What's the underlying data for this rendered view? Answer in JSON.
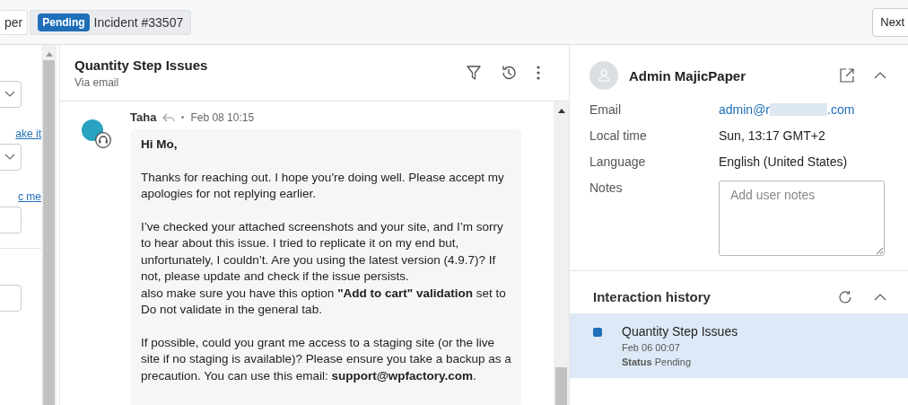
{
  "tabs": [
    {
      "label": "per",
      "selected": false
    },
    {
      "label": "Incident #33507",
      "badge": "Pending",
      "selected": true
    }
  ],
  "next_button": "Next",
  "left_panel": {
    "link_1": "ake it",
    "link_2": "c me"
  },
  "ticket": {
    "title": "Quantity Step Issues",
    "channel": "Via email"
  },
  "message": {
    "author": "Taha",
    "time": "Feb 08 10:15",
    "greeting": "Hi Mo,",
    "paragraphs": [
      "Thanks for reaching out. I hope you're doing well. Please accept my apologies for not replying earlier.",
      "I’ve checked your attached screenshots and your site, and I’m sorry to hear about this issue. I tried to replicate it on my end but, unfortunately, I couldn’t. Are you using the latest version (4.9.7)? If not, please update and check if the issue persists.\nalso make sure you have this option **\"Add to cart\" validation** set to Do not validate in the general tab.",
      "If possible, could you grant me access to a staging site (or the live site if no staging is available)? Please ensure you take a backup as a precaution. You can use this email: **support@wpfactory.com**."
    ]
  },
  "contact": {
    "name": "Admin MajicPaper",
    "fields": [
      {
        "label": "Email",
        "kind": "link",
        "value": "admin@r",
        "value_end": ".com"
      },
      {
        "label": "Local time",
        "kind": "text",
        "value": "Sun, 13:17 GMT+2"
      },
      {
        "label": "Language",
        "kind": "text",
        "value": "English (United States)"
      },
      {
        "label": "Notes",
        "kind": "textarea",
        "placeholder": "Add user notes"
      }
    ]
  },
  "history": {
    "title": "Interaction history",
    "items": [
      {
        "title": "Quantity Step Issues",
        "date": "Feb 06 00:07",
        "status_label": "Status",
        "status": "Pending",
        "color": "#1f6fb8",
        "selected": true
      }
    ]
  }
}
